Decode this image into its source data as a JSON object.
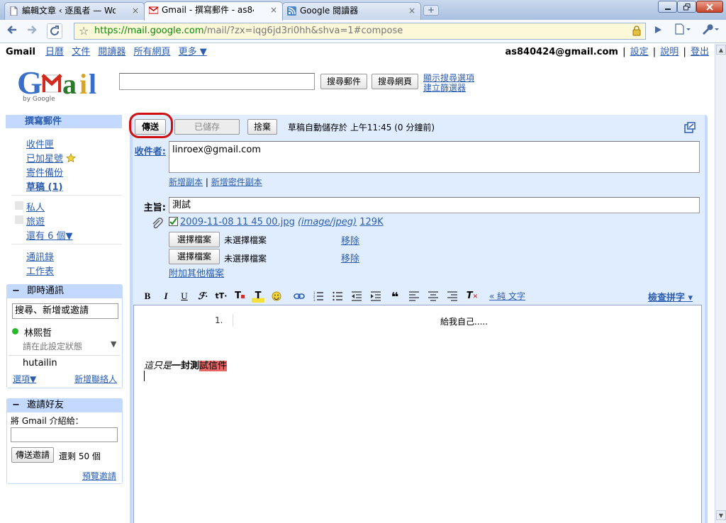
{
  "browser": {
    "tabs": [
      {
        "label": "編輯文章 ‹ 逐風者 — Wo…",
        "close": "×",
        "icon": "document-icon"
      },
      {
        "label": "Gmail - 撰寫郵件 - as8404…",
        "close": "×",
        "icon": "gmail-icon"
      },
      {
        "label": "Google 閱讀器",
        "close": "×",
        "icon": "rss-icon"
      }
    ],
    "new_tab": "+",
    "url_host": "https://mail.google.com",
    "url_path": "/mail/?zx=iqg6jd3ri0hh&shva=1#compose"
  },
  "gbar": {
    "brand": "Gmail",
    "links": [
      "日曆",
      "文件",
      "閱讀器",
      "所有網頁",
      "更多 ▼"
    ],
    "account": "as840424@gmail.com",
    "sep": "|",
    "right_links": [
      "設定",
      "說明",
      "登出"
    ]
  },
  "logo": {
    "by": "by Google"
  },
  "search": {
    "search_mail": "搜尋郵件",
    "search_web": "搜尋網頁",
    "show_options": "顯示搜尋選項",
    "create_filter": "建立篩選器"
  },
  "sidebar": {
    "compose": "撰寫郵件",
    "inbox": "收件匣",
    "starred": "已加星號",
    "sent": "寄件備份",
    "drafts": "草稿 (1)",
    "labels": [
      "私人",
      "旅遊"
    ],
    "more": "還有 6 個▼",
    "contacts": "通訊錄",
    "tasks": "工作表",
    "chat": {
      "title": "即時通訊",
      "collapse": "−",
      "search_value": "搜尋、新增或邀請",
      "me": "林熙哲",
      "status": "請在此設定狀態",
      "contact": "hutailin",
      "options": "選項▼",
      "add": "新增聯絡人"
    },
    "invite": {
      "title": "邀請好友",
      "collapse": "−",
      "prompt": "將 Gmail 介紹給：",
      "send": "傳送邀請",
      "left": "還剩 50 個",
      "preview": "預覽邀請"
    }
  },
  "compose": {
    "send": "傳送",
    "saved": "已儲存",
    "discard": "捨棄",
    "autosave": "草稿自動儲存於 上午11:45 (0 分鐘前)",
    "to_label": "收件者:",
    "to_value": "linroex@gmail.com",
    "add_cc": "新增副本",
    "sep": "|",
    "add_bcc": "新增密件副本",
    "subject_label": "主旨:",
    "subject_value": "測試",
    "attachment_name": "2009-11-08 11 45 00.jpg",
    "attachment_type": "(image/jpeg)",
    "attachment_size": "129K",
    "choose_file": "選擇檔案",
    "no_file": "未選擇檔案",
    "remove": "移除",
    "attach_more": "附加其他檔案",
    "plain_text": "« 純 文字",
    "spellcheck": "檢查拼字 ▾",
    "body_list_num": "1.",
    "body_list_text": "給我自己.....",
    "body_italic": "這只是",
    "body_bold": "一封測",
    "body_highlight": "試信件"
  },
  "colors": {
    "accent": "#c3d9ff",
    "panel_bg": "#e0ecff",
    "link": "#2a5db0",
    "highlight": "#e66565",
    "circle": "#d01010"
  }
}
